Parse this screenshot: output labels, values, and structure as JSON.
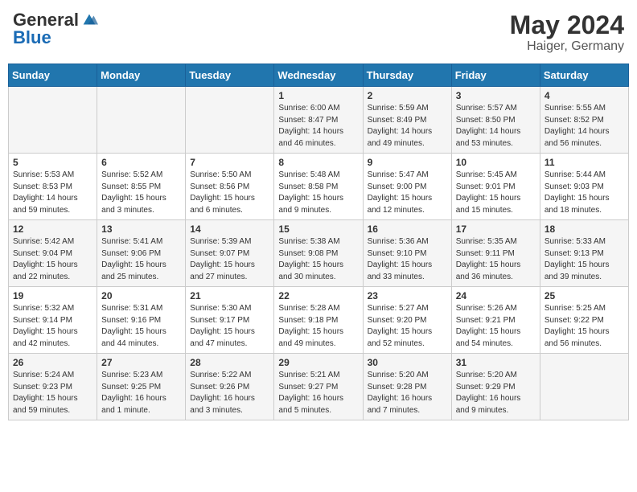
{
  "header": {
    "logo_general": "General",
    "logo_blue": "Blue",
    "month": "May 2024",
    "location": "Haiger, Germany"
  },
  "weekdays": [
    "Sunday",
    "Monday",
    "Tuesday",
    "Wednesday",
    "Thursday",
    "Friday",
    "Saturday"
  ],
  "weeks": [
    [
      {
        "day": null
      },
      {
        "day": null
      },
      {
        "day": null
      },
      {
        "day": "1",
        "sunrise": "Sunrise: 6:00 AM",
        "sunset": "Sunset: 8:47 PM",
        "daylight": "Daylight: 14 hours and 46 minutes."
      },
      {
        "day": "2",
        "sunrise": "Sunrise: 5:59 AM",
        "sunset": "Sunset: 8:49 PM",
        "daylight": "Daylight: 14 hours and 49 minutes."
      },
      {
        "day": "3",
        "sunrise": "Sunrise: 5:57 AM",
        "sunset": "Sunset: 8:50 PM",
        "daylight": "Daylight: 14 hours and 53 minutes."
      },
      {
        "day": "4",
        "sunrise": "Sunrise: 5:55 AM",
        "sunset": "Sunset: 8:52 PM",
        "daylight": "Daylight: 14 hours and 56 minutes."
      }
    ],
    [
      {
        "day": "5",
        "sunrise": "Sunrise: 5:53 AM",
        "sunset": "Sunset: 8:53 PM",
        "daylight": "Daylight: 14 hours and 59 minutes."
      },
      {
        "day": "6",
        "sunrise": "Sunrise: 5:52 AM",
        "sunset": "Sunset: 8:55 PM",
        "daylight": "Daylight: 15 hours and 3 minutes."
      },
      {
        "day": "7",
        "sunrise": "Sunrise: 5:50 AM",
        "sunset": "Sunset: 8:56 PM",
        "daylight": "Daylight: 15 hours and 6 minutes."
      },
      {
        "day": "8",
        "sunrise": "Sunrise: 5:48 AM",
        "sunset": "Sunset: 8:58 PM",
        "daylight": "Daylight: 15 hours and 9 minutes."
      },
      {
        "day": "9",
        "sunrise": "Sunrise: 5:47 AM",
        "sunset": "Sunset: 9:00 PM",
        "daylight": "Daylight: 15 hours and 12 minutes."
      },
      {
        "day": "10",
        "sunrise": "Sunrise: 5:45 AM",
        "sunset": "Sunset: 9:01 PM",
        "daylight": "Daylight: 15 hours and 15 minutes."
      },
      {
        "day": "11",
        "sunrise": "Sunrise: 5:44 AM",
        "sunset": "Sunset: 9:03 PM",
        "daylight": "Daylight: 15 hours and 18 minutes."
      }
    ],
    [
      {
        "day": "12",
        "sunrise": "Sunrise: 5:42 AM",
        "sunset": "Sunset: 9:04 PM",
        "daylight": "Daylight: 15 hours and 22 minutes."
      },
      {
        "day": "13",
        "sunrise": "Sunrise: 5:41 AM",
        "sunset": "Sunset: 9:06 PM",
        "daylight": "Daylight: 15 hours and 25 minutes."
      },
      {
        "day": "14",
        "sunrise": "Sunrise: 5:39 AM",
        "sunset": "Sunset: 9:07 PM",
        "daylight": "Daylight: 15 hours and 27 minutes."
      },
      {
        "day": "15",
        "sunrise": "Sunrise: 5:38 AM",
        "sunset": "Sunset: 9:08 PM",
        "daylight": "Daylight: 15 hours and 30 minutes."
      },
      {
        "day": "16",
        "sunrise": "Sunrise: 5:36 AM",
        "sunset": "Sunset: 9:10 PM",
        "daylight": "Daylight: 15 hours and 33 minutes."
      },
      {
        "day": "17",
        "sunrise": "Sunrise: 5:35 AM",
        "sunset": "Sunset: 9:11 PM",
        "daylight": "Daylight: 15 hours and 36 minutes."
      },
      {
        "day": "18",
        "sunrise": "Sunrise: 5:33 AM",
        "sunset": "Sunset: 9:13 PM",
        "daylight": "Daylight: 15 hours and 39 minutes."
      }
    ],
    [
      {
        "day": "19",
        "sunrise": "Sunrise: 5:32 AM",
        "sunset": "Sunset: 9:14 PM",
        "daylight": "Daylight: 15 hours and 42 minutes."
      },
      {
        "day": "20",
        "sunrise": "Sunrise: 5:31 AM",
        "sunset": "Sunset: 9:16 PM",
        "daylight": "Daylight: 15 hours and 44 minutes."
      },
      {
        "day": "21",
        "sunrise": "Sunrise: 5:30 AM",
        "sunset": "Sunset: 9:17 PM",
        "daylight": "Daylight: 15 hours and 47 minutes."
      },
      {
        "day": "22",
        "sunrise": "Sunrise: 5:28 AM",
        "sunset": "Sunset: 9:18 PM",
        "daylight": "Daylight: 15 hours and 49 minutes."
      },
      {
        "day": "23",
        "sunrise": "Sunrise: 5:27 AM",
        "sunset": "Sunset: 9:20 PM",
        "daylight": "Daylight: 15 hours and 52 minutes."
      },
      {
        "day": "24",
        "sunrise": "Sunrise: 5:26 AM",
        "sunset": "Sunset: 9:21 PM",
        "daylight": "Daylight: 15 hours and 54 minutes."
      },
      {
        "day": "25",
        "sunrise": "Sunrise: 5:25 AM",
        "sunset": "Sunset: 9:22 PM",
        "daylight": "Daylight: 15 hours and 56 minutes."
      }
    ],
    [
      {
        "day": "26",
        "sunrise": "Sunrise: 5:24 AM",
        "sunset": "Sunset: 9:23 PM",
        "daylight": "Daylight: 15 hours and 59 minutes."
      },
      {
        "day": "27",
        "sunrise": "Sunrise: 5:23 AM",
        "sunset": "Sunset: 9:25 PM",
        "daylight": "Daylight: 16 hours and 1 minute."
      },
      {
        "day": "28",
        "sunrise": "Sunrise: 5:22 AM",
        "sunset": "Sunset: 9:26 PM",
        "daylight": "Daylight: 16 hours and 3 minutes."
      },
      {
        "day": "29",
        "sunrise": "Sunrise: 5:21 AM",
        "sunset": "Sunset: 9:27 PM",
        "daylight": "Daylight: 16 hours and 5 minutes."
      },
      {
        "day": "30",
        "sunrise": "Sunrise: 5:20 AM",
        "sunset": "Sunset: 9:28 PM",
        "daylight": "Daylight: 16 hours and 7 minutes."
      },
      {
        "day": "31",
        "sunrise": "Sunrise: 5:20 AM",
        "sunset": "Sunset: 9:29 PM",
        "daylight": "Daylight: 16 hours and 9 minutes."
      },
      {
        "day": null
      }
    ]
  ]
}
